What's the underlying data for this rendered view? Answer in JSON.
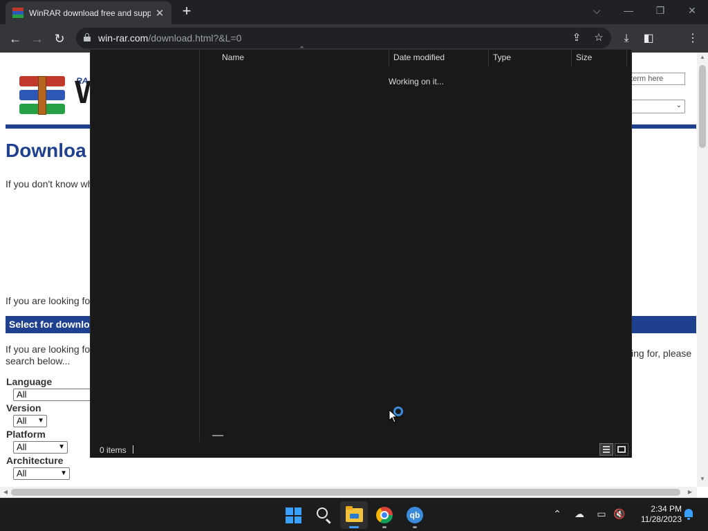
{
  "browser": {
    "tab_title": "WinRAR download free and support",
    "tab_close": "✕",
    "new_tab": "+",
    "url_host": "win-rar.com",
    "url_path": "/download.html?&L=0",
    "window_controls": {
      "dropdown": "⌵",
      "minimize": "—",
      "restore": "❐",
      "close": "✕"
    }
  },
  "page": {
    "logo_sub": "RA",
    "logo_text": "W",
    "search_placeholder": "n term here",
    "heading": "Downloa",
    "intro": "If you don't know wh",
    "looking_for": "If you are looking fo",
    "section_title": "Select for downlo",
    "section_text_left": "If you are looking fo",
    "section_text_right": "king for, please",
    "search_below": "search below...",
    "filters": [
      {
        "label": "Language",
        "value": "All"
      },
      {
        "label": "Version",
        "value": "All"
      },
      {
        "label": "Platform",
        "value": "All"
      },
      {
        "label": "Architecture",
        "value": "All"
      }
    ]
  },
  "dialog": {
    "columns": {
      "name": "Name",
      "date": "Date modified",
      "type": "Type",
      "size": "Size"
    },
    "status_message": "Working on it...",
    "items_count": "0 items"
  },
  "taskbar": {
    "time": "2:34 PM",
    "date": "11/28/2023"
  },
  "colors": {
    "brand_blue": "#1f3f8f",
    "accent": "#3aa0ff",
    "dialog_bg": "#191919"
  },
  "icons": [
    "lock-icon",
    "google-icon",
    "share-icon",
    "star-icon",
    "download-icon",
    "side-panel-icon",
    "profile-icon",
    "menu-icon",
    "start-icon",
    "search-icon",
    "file-explorer-icon",
    "chrome-icon",
    "qbittorrent-icon",
    "chevron-up-icon",
    "onedrive-icon",
    "network-icon",
    "volume-mute-icon",
    "notification-bell-icon"
  ]
}
